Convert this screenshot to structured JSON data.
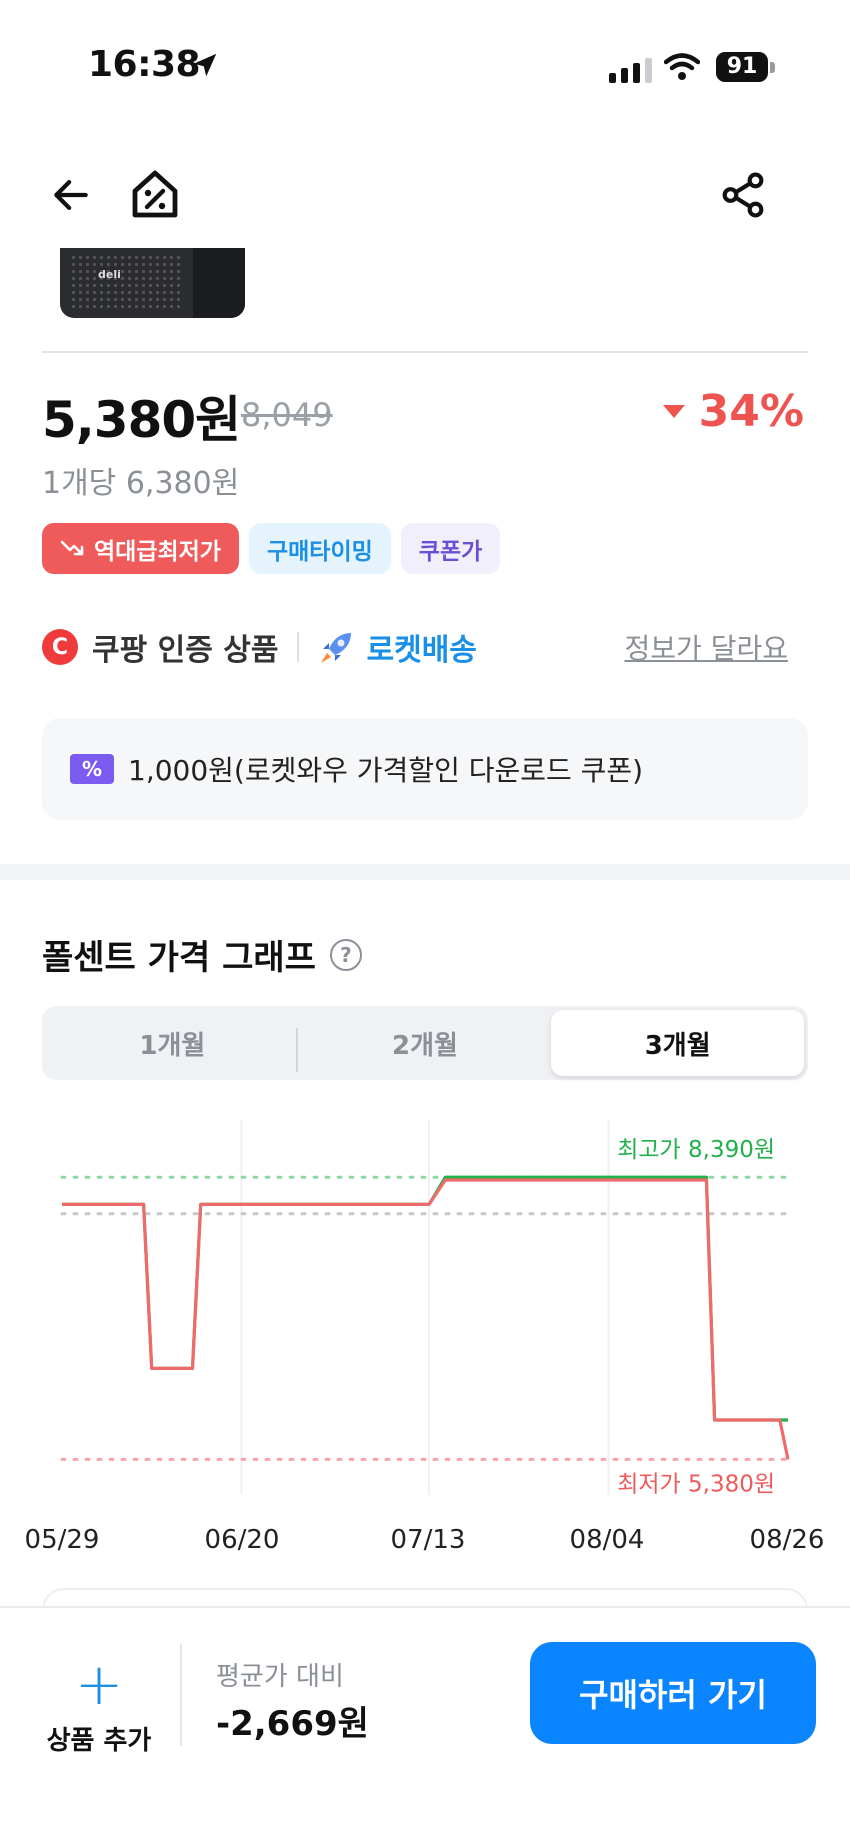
{
  "status_bar": {
    "time": "16:38",
    "battery": "91"
  },
  "product": {
    "price": "5,380원",
    "original_price": "8,049",
    "discount": "34%",
    "unit_price": "1개당 6,380원",
    "tags": [
      "역대급최저가",
      "구매타이밍",
      "쿠폰가"
    ],
    "cert_icon": "C",
    "cert_label": "쿠팡 인증 상품",
    "rocket_label": "로켓배송",
    "info_link": "정보가 달라요",
    "coupon_icon": "%",
    "coupon_text": "1,000원(로켓와우 가격할인 다운로드 쿠폰)"
  },
  "graph": {
    "title": "폴센트 가격 그래프",
    "help_icon": "?",
    "tabs": [
      "1개월",
      "2개월",
      "3개월"
    ],
    "active_tab": "3개월",
    "max_label": "최고가 8,390원",
    "min_label": "최저가 5,380원"
  },
  "chart_data": {
    "type": "line",
    "x_tick_labels": [
      "05/29",
      "06/20",
      "07/13",
      "08/04",
      "08/26"
    ],
    "series": [
      {
        "color": "#22b14c",
        "x": [
          "05/29",
          "06/08",
          "06/09",
          "06/14",
          "06/15",
          "07/13",
          "07/15",
          "07/22",
          "08/16",
          "08/17",
          "08/26"
        ],
        "values": [
          8100,
          8100,
          6350,
          6350,
          8100,
          8100,
          8390,
          8390,
          8390,
          5800,
          5800
        ]
      },
      {
        "color": "#ef6a6a",
        "x": [
          "05/29",
          "06/08",
          "06/09",
          "06/14",
          "06/15",
          "07/13",
          "07/15",
          "08/16",
          "08/17",
          "08/25",
          "08/26"
        ],
        "values": [
          8100,
          8100,
          6350,
          6350,
          8100,
          8100,
          8360,
          8360,
          5800,
          5800,
          5380
        ]
      }
    ],
    "reference_lines": [
      {
        "label": "최고가 8,390원",
        "value": 8390,
        "color": "#8fd9a4"
      },
      {
        "value": 8000,
        "color": "#c4c7cb"
      },
      {
        "label": "최저가 5,380원",
        "value": 5380,
        "color": "#f4a5a5"
      }
    ],
    "ylim": [
      5000,
      9000
    ],
    "grid": true
  },
  "bottom": {
    "add_label": "상품 추가",
    "avg_label": "평균가 대비",
    "avg_value": "-2,669원",
    "buy_label": "구매하러 가기"
  },
  "colors": {
    "accent": "#0a84ff",
    "discount": "#ef5350",
    "rocket": "#1a8fe6"
  },
  "icons": {
    "nav_back": "arrow-left-icon",
    "nav_home": "home-percent-icon",
    "nav_share": "share-icon",
    "tag_red": "trend-down-icon",
    "rocket": "rocket-icon",
    "coupon": "coupon-icon",
    "help": "question-circle-icon",
    "add": "plus-icon"
  }
}
